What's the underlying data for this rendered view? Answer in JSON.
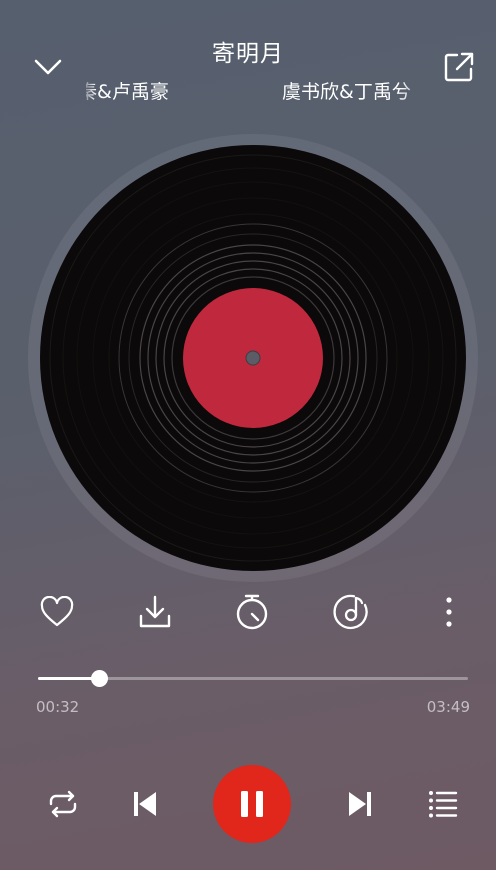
{
  "song": {
    "title": "寄明月"
  },
  "artists": {
    "left_text": "秦&卢禹豪",
    "right_text": "虞书欣&丁禹兮"
  },
  "progress": {
    "current": "00:32",
    "total": "03:49",
    "fraction": 0.143
  },
  "player": {
    "state": "playing"
  },
  "colors": {
    "play_button": "#e1261c",
    "record_label": "#c0283e",
    "record": "#0b0909"
  },
  "icons": {
    "back": "chevron-down-icon",
    "share": "external-link-icon",
    "favorite": "heart-icon",
    "download": "download-icon",
    "timer": "timer-icon",
    "effects": "music-disc-icon",
    "more": "more-vertical-icon",
    "repeat": "repeat-icon",
    "previous": "skip-previous-icon",
    "pause": "pause-icon",
    "next": "skip-next-icon",
    "playlist": "playlist-icon"
  }
}
